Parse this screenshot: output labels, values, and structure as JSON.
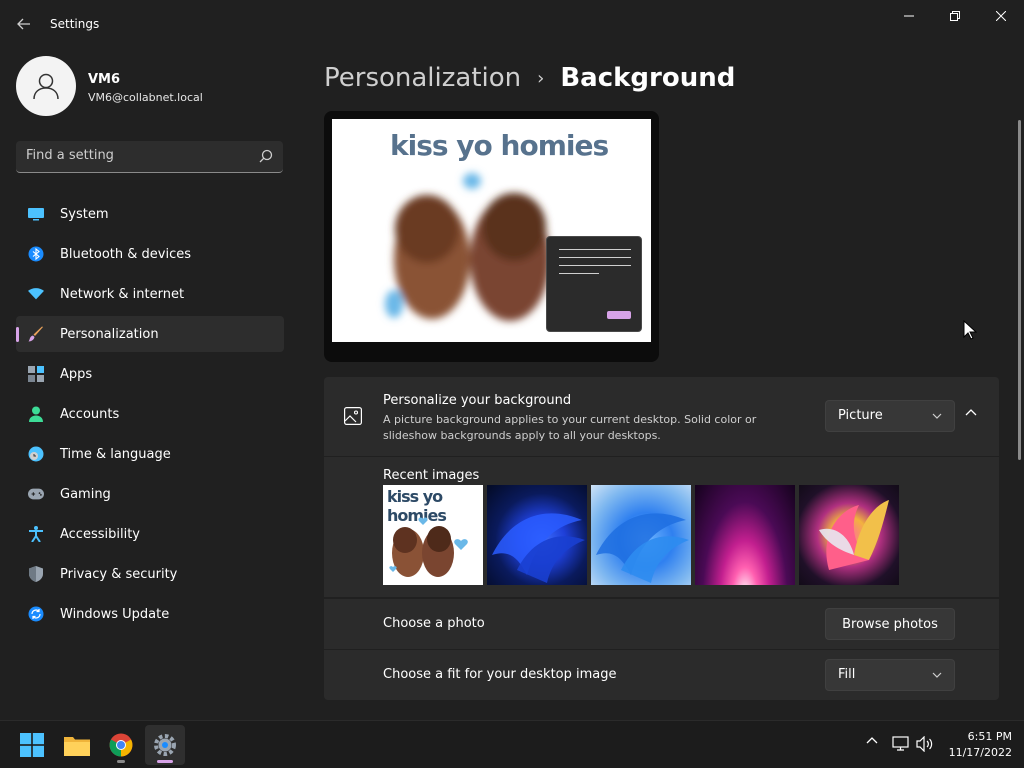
{
  "window": {
    "title": "Settings"
  },
  "profile": {
    "name": "VM6",
    "email": "VM6@collabnet.local"
  },
  "search": {
    "placeholder": "Find a setting"
  },
  "nav": {
    "items": [
      {
        "label": "System",
        "icon": "monitor-icon"
      },
      {
        "label": "Bluetooth & devices",
        "icon": "bluetooth-icon"
      },
      {
        "label": "Network & internet",
        "icon": "wifi-icon"
      },
      {
        "label": "Personalization",
        "icon": "brush-icon",
        "active": true
      },
      {
        "label": "Apps",
        "icon": "apps-icon"
      },
      {
        "label": "Accounts",
        "icon": "person-icon"
      },
      {
        "label": "Time & language",
        "icon": "clock-globe-icon"
      },
      {
        "label": "Gaming",
        "icon": "gamepad-icon"
      },
      {
        "label": "Accessibility",
        "icon": "accessibility-icon"
      },
      {
        "label": "Privacy & security",
        "icon": "shield-icon"
      },
      {
        "label": "Windows Update",
        "icon": "update-icon"
      }
    ]
  },
  "breadcrumb": {
    "parent": "Personalization",
    "separator": "›",
    "current": "Background"
  },
  "preview": {
    "image_text": "kiss yo homies"
  },
  "background": {
    "title": "Personalize your background",
    "description": "A picture background applies to your current desktop. Solid color or slideshow backgrounds apply to all your desktops.",
    "type_value": "Picture"
  },
  "recent": {
    "label": "Recent images",
    "thumb1_text": "kiss yo homies"
  },
  "choose_photo": {
    "label": "Choose a photo",
    "button": "Browse photos"
  },
  "fit": {
    "label": "Choose a fit for your desktop image",
    "value": "Fill"
  },
  "taskbar": {
    "time": "6:51 PM",
    "date": "11/17/2022"
  },
  "colors": {
    "accent": "#d7a3e8",
    "background": "#202020",
    "card": "#2b2b2b"
  }
}
